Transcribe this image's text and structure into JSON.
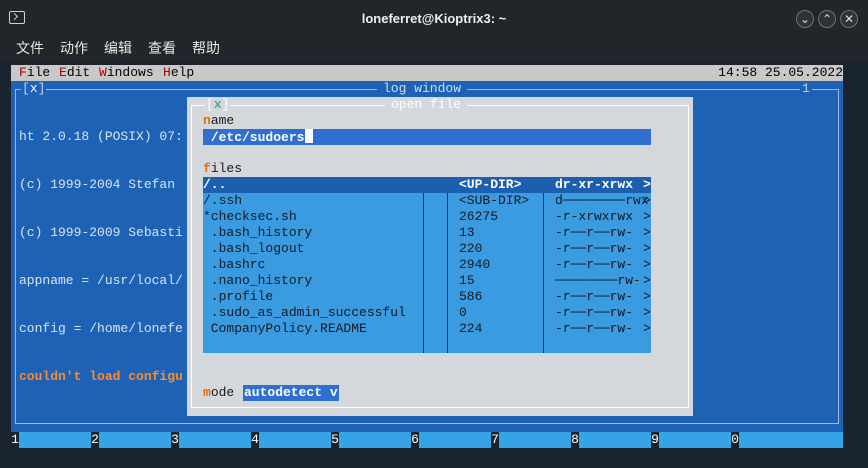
{
  "window": {
    "title": "loneferret@Kioptrix3: ~",
    "icon": "terminal-icon",
    "buttons": [
      "minimize",
      "maximize",
      "close"
    ],
    "button_glyphs": {
      "minimize": "⌄",
      "maximize": "⌃",
      "close": "✕"
    }
  },
  "menubar": {
    "items": [
      "文件",
      "动作",
      "编辑",
      "查看",
      "帮助"
    ]
  },
  "ht": {
    "menu": [
      {
        "hotkey": "F",
        "rest": "ile"
      },
      {
        "hotkey": "E",
        "rest": "dit"
      },
      {
        "hotkey": "W",
        "rest": "indows"
      },
      {
        "hotkey": "H",
        "rest": "elp"
      }
    ],
    "clock": "14:58 25.05.2022",
    "log_window": {
      "close_box_left": "[",
      "close_box_x": "x",
      "close_box_right": "]",
      "title": "log window",
      "number": "1",
      "lines": [
        "ht 2.0.18 (POSIX) 07:",
        "(c) 1999-2004 Stefan ",
        "(c) 1999-2009 Sebasti",
        "appname = /usr/local/",
        "config = /home/lonefe"
      ],
      "error_line": "couldn't load configu"
    },
    "open_file": {
      "close_box_left": "[",
      "close_box_x": "x",
      "close_box_right": "]",
      "title": "open file",
      "name_label_hotkey": "n",
      "name_label_rest": "ame",
      "name_value": " /etc/sudoers",
      "files_label_hotkey": "f",
      "files_label_rest": "iles",
      "files": [
        {
          "name": "/..",
          "size": "<UP-DIR>",
          "perm": "dr-xr-xrwx",
          "more": ">"
        },
        {
          "name": "/.ssh",
          "size": "<SUB-DIR>",
          "perm": "d────────rwx",
          "more": ">"
        },
        {
          "name": "*checksec.sh",
          "size": "26275",
          "perm": "-r-xrwxrwx",
          "more": ">"
        },
        {
          "name": " .bash_history",
          "size": "13",
          "perm": "-r──r──rw-",
          "more": ">"
        },
        {
          "name": " .bash_logout",
          "size": "220",
          "perm": "-r──r──rw-",
          "more": ">"
        },
        {
          "name": " .bashrc",
          "size": "2940",
          "perm": "-r──r──rw-",
          "more": ">"
        },
        {
          "name": " .nano_history",
          "size": "15",
          "perm": "────────rw-",
          "more": ">"
        },
        {
          "name": " .profile",
          "size": "586",
          "perm": "-r──r──rw-",
          "more": ">"
        },
        {
          "name": " .sudo_as_admin_successful",
          "size": "0",
          "perm": "-r──r──rw-",
          "more": ">"
        },
        {
          "name": " CompanyPolicy.README",
          "size": "224",
          "perm": "-r──r──rw-",
          "more": ">"
        }
      ],
      "mode_label_hotkey": "m",
      "mode_label_rest": "ode",
      "mode_value": "autodetect v"
    },
    "fkeys": [
      {
        "key": "1",
        "label": ""
      },
      {
        "key": "2",
        "label": ""
      },
      {
        "key": "3",
        "label": ""
      },
      {
        "key": "4",
        "label": ""
      },
      {
        "key": "5",
        "label": ""
      },
      {
        "key": "6",
        "label": ""
      },
      {
        "key": "7",
        "label": ""
      },
      {
        "key": "8",
        "label": ""
      },
      {
        "key": "9",
        "label": ""
      },
      {
        "key": "0",
        "label": ""
      }
    ]
  },
  "colors": {
    "desktop_blue": "#1e62b6",
    "dialog_grey": "#d4d8dd",
    "list_blue": "#3b9be0",
    "selection_blue": "#1c5fb0",
    "hotkey_orange": "#e07000",
    "error_orange": "#ff8a26"
  }
}
